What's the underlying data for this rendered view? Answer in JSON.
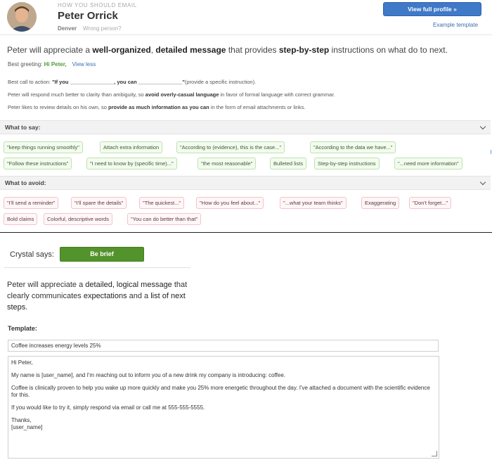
{
  "header": {
    "eyebrow": "HOW YOU SHOULD EMAIL",
    "name": "Peter Orrick",
    "location": "Denver",
    "wrong_person": "Wrong person?",
    "view_profile": "View full profile »",
    "example_template": "Example template"
  },
  "summary": {
    "pre": "Peter will appreciate a ",
    "b1": "well-organized",
    "mid1": ", ",
    "b2": "detailed message",
    "mid2": " that provides ",
    "b3": "step-by-step",
    "post": " instructions on what do to next."
  },
  "greeting": {
    "label": "Best greeting: ",
    "value": "Hi Peter,",
    "view_less": "View less"
  },
  "details": {
    "cta_label": "Best call to action: ",
    "cta_b1": "\"If you _______________, you can _______________\"",
    "cta_post": "(provide a specific instruction).",
    "l2_pre": "Peter will respond much better to clarity than ambiguity, so ",
    "l2_b": "avoid overly-casual language",
    "l2_post": " in favor of formal language with correct grammar.",
    "l3_pre": "Peter likes to review details on his own, so ",
    "l3_b": "provide as much information as you can",
    "l3_post": " in the form of email attachments or links."
  },
  "sections": {
    "say": "What to say:",
    "avoid": "What to avoid:"
  },
  "say_chips": [
    "\"keep things running smoothly\"",
    "Attach extra information",
    "\"According to (evidence), this is the case...\"",
    "\"According to the data we have...\"",
    "\"Follow these instructions\"",
    "\"I need to know by (specific time)...\"",
    "\"the most reasonable\"",
    "Bulleted lists",
    "Step-by-step instructions",
    "\"...need more information\""
  ],
  "avoid_chips": [
    "\"I'll send a reminder\"",
    "\"I'll spare the details\"",
    "\"The quickest...\"",
    "\"How do you feel about...\"",
    "\"...what your team thinks\"",
    "Exaggerating",
    "\"Don't forget...\"",
    "Bold claims",
    "Colorful, descriptive words",
    "\"You can do better than that\""
  ],
  "crystal": {
    "label": "Crystal says:",
    "button": "Be brief",
    "t1": "Peter will appreciate a ",
    "t1b": "detailed, logical message",
    "t2": " that clearly communicates ",
    "t2b": "expectations",
    "t3": " and a ",
    "t3b": "list of next steps",
    "t4": "."
  },
  "template": {
    "label": "Template:",
    "subject": "Coffee increases energy levels 25%",
    "p1": "Hi Peter,",
    "p2": "My name is [user_name], and I'm reaching out to inform you of a new drink my company is introducing: coffee.",
    "p3": "Coffee is clinically proven to help you wake up more quickly and make you 25% more energetic throughout the day. I've attached a document with the scientific evidence for this.",
    "p4": "If you would like to try it, simply respond via email or call me at 555-555-5555.",
    "p5": "Thanks,\n[user_name]"
  }
}
